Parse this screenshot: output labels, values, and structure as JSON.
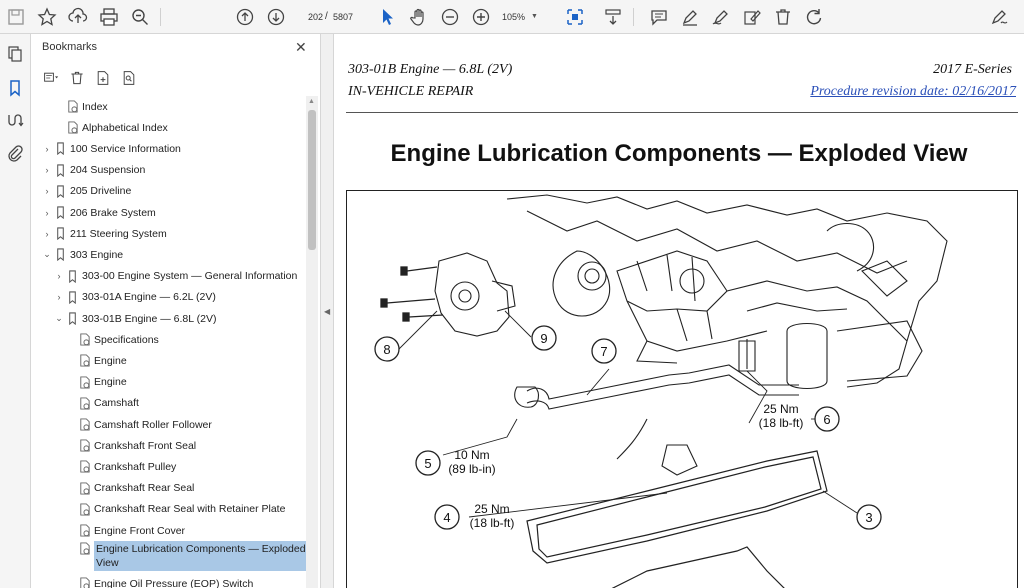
{
  "toolbar": {
    "page_current": "202",
    "page_sep": "/",
    "page_total": "5807",
    "zoom": "105%",
    "icons": [
      "save-icon",
      "bookmark-star-icon",
      "upload-icon",
      "print-icon",
      "zoom-search-icon",
      "page-up-icon",
      "page-down-icon",
      "select-cursor-icon",
      "hand-tool-icon",
      "zoom-out-icon",
      "zoom-in-icon",
      "page-fit-icon",
      "scroll-mode-icon",
      "comment-icon",
      "highlight-pen-icon",
      "draw-icon",
      "edit-text-icon",
      "delete-icon",
      "rotate-icon",
      "sign-icon"
    ]
  },
  "sidebar": {
    "title": "Bookmarks",
    "close": "✕",
    "items": [
      {
        "label": "Index",
        "level": 1,
        "chev": "",
        "icon": "doc"
      },
      {
        "label": "Alphabetical Index",
        "level": 1,
        "chev": "",
        "icon": "doc"
      },
      {
        "label": "100 Service Information",
        "level": 0,
        "chev": "›",
        "icon": "bm"
      },
      {
        "label": "204 Suspension",
        "level": 0,
        "chev": "›",
        "icon": "bm"
      },
      {
        "label": "205 Driveline",
        "level": 0,
        "chev": "›",
        "icon": "bm"
      },
      {
        "label": "206 Brake System",
        "level": 0,
        "chev": "›",
        "icon": "bm"
      },
      {
        "label": "211 Steering System",
        "level": 0,
        "chev": "›",
        "icon": "bm"
      },
      {
        "label": "303 Engine",
        "level": 0,
        "chev": "⌄",
        "icon": "bm"
      },
      {
        "label": "303-00 Engine System — General Information",
        "level": 1,
        "chev": "›",
        "icon": "bm"
      },
      {
        "label": "303-01A Engine — 6.2L (2V)",
        "level": 1,
        "chev": "›",
        "icon": "bm"
      },
      {
        "label": "303-01B Engine — 6.8L (2V)",
        "level": 1,
        "chev": "⌄",
        "icon": "bm"
      },
      {
        "label": "Specifications",
        "level": 2,
        "chev": "",
        "icon": "doc"
      },
      {
        "label": "Engine",
        "level": 2,
        "chev": "",
        "icon": "doc"
      },
      {
        "label": "Engine",
        "level": 2,
        "chev": "",
        "icon": "doc"
      },
      {
        "label": "Camshaft",
        "level": 2,
        "chev": "",
        "icon": "doc"
      },
      {
        "label": "Camshaft Roller Follower",
        "level": 2,
        "chev": "",
        "icon": "doc"
      },
      {
        "label": "Crankshaft Front Seal",
        "level": 2,
        "chev": "",
        "icon": "doc"
      },
      {
        "label": "Crankshaft Pulley",
        "level": 2,
        "chev": "",
        "icon": "doc"
      },
      {
        "label": "Crankshaft Rear Seal",
        "level": 2,
        "chev": "",
        "icon": "doc"
      },
      {
        "label": "Crankshaft Rear Seal with Retainer Plate",
        "level": 2,
        "chev": "",
        "icon": "doc"
      },
      {
        "label": "Engine Front Cover",
        "level": 2,
        "chev": "",
        "icon": "doc"
      },
      {
        "label": "Engine Lubrication Components — Exploded",
        "label2": "View",
        "level": 2,
        "chev": "",
        "icon": "doc",
        "selected": true
      },
      {
        "label": "Engine Oil Pressure (EOP) Switch",
        "level": 2,
        "chev": "",
        "icon": "doc"
      }
    ]
  },
  "document": {
    "header_left_1": "303-01B Engine — 6.8L (2V)",
    "header_left_2": "IN-VEHICLE REPAIR",
    "header_right_1": "2017 E-Series",
    "header_right_2": "Procedure revision date: 02/16/2017",
    "title": "Engine Lubrication Components — Exploded View",
    "figure": {
      "callouts": [
        "8",
        "9",
        "7",
        "6",
        "5",
        "4",
        "3"
      ],
      "torque_6_nm": "25 Nm",
      "torque_6_lbft": "(18 lb-ft)",
      "torque_5_nm": "10 Nm",
      "torque_5_lbin": "(89 lb-in)",
      "torque_4_nm": "25 Nm",
      "torque_4_lbft": "(18 lb-ft)"
    }
  }
}
